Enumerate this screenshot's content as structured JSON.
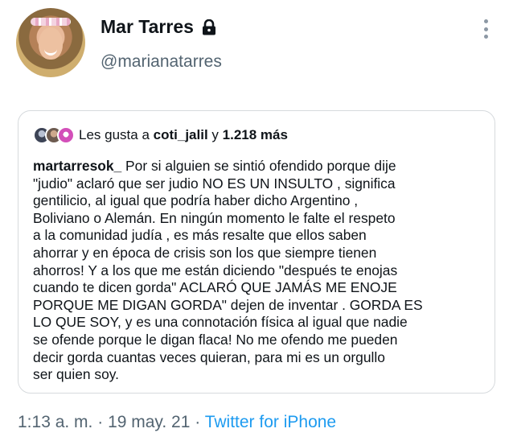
{
  "profile": {
    "display_name": "Mar Tarres",
    "handle": "@marianatarres",
    "protected_icon": "lock-icon",
    "more_icon": "more-vertical-icon"
  },
  "likes": {
    "prefix": "Les gusta a",
    "user": "coti_jalil",
    "conjunction": "y",
    "count": "1.218 más"
  },
  "post": {
    "author": "martarresok_",
    "first_line_rest": " Por si alguien se sintió ofendido porque dije",
    "lines": [
      "\"judio\" aclaró que ser judio NO ES UN INSULTO , significa",
      "gentilicio, al igual que podría haber dicho Argentino ,",
      "Boliviano o Alemán. En ningún momento le falte el respeto",
      "a la comunidad judía , es más resalte que ellos saben",
      "ahorrar y en época de crisis son los que siempre tienen",
      "ahorros! Y a los que me están diciendo \"después te enojas",
      "cuando te dicen gorda\" ACLARÓ QUE JAMÁS ME ENOJE",
      "PORQUE ME DIGAN GORDA\" dejen de inventar . GORDA ES",
      "LO QUE SOY, y es una connotación física al igual que nadie",
      "se ofende porque le digan flaca! No me ofendo me pueden",
      "decir gorda cuantas veces quieran, para mi es un orgullo",
      "ser quien soy."
    ]
  },
  "meta": {
    "time": "1:13 a. m.",
    "separator": " · ",
    "date": "19 may. 21",
    "source": "Twitter for iPhone"
  }
}
